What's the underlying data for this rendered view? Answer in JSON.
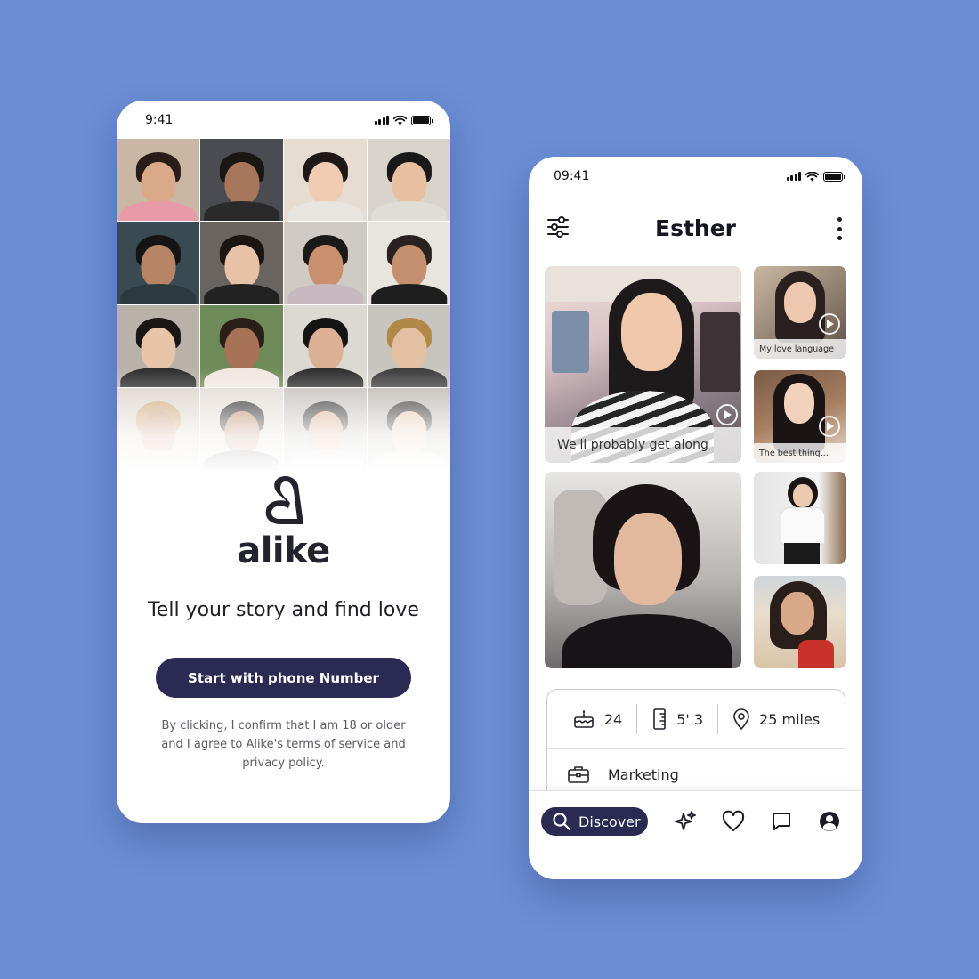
{
  "background_color": "#6a8dd4",
  "accent_color": "#2a2a52",
  "left_screen": {
    "status_time": "9:41",
    "logo_text": "alike",
    "tagline": "Tell your story and find love",
    "cta_label": "Start with phone Number",
    "disclaimer": "By clicking, I confirm that I am 18 or older and I agree to Alike's terms of service and privacy policy."
  },
  "right_screen": {
    "status_time": "09:41",
    "profile_name": "Esther",
    "media": [
      {
        "caption": "We'll probably get along",
        "type": "video"
      },
      {
        "caption": "My love language",
        "type": "video"
      },
      {
        "caption": "The best thing...",
        "type": "video"
      },
      {
        "caption": "",
        "type": "photo"
      },
      {
        "caption": "",
        "type": "photo"
      },
      {
        "caption": "",
        "type": "photo"
      }
    ],
    "stats": {
      "age": "24",
      "height": "5' 3",
      "distance": "25 miles"
    },
    "job": "Marketing",
    "nav": {
      "discover_label": "Discover",
      "icons": [
        "sparkle-icon",
        "heart-icon",
        "chat-icon",
        "profile-icon"
      ]
    }
  }
}
